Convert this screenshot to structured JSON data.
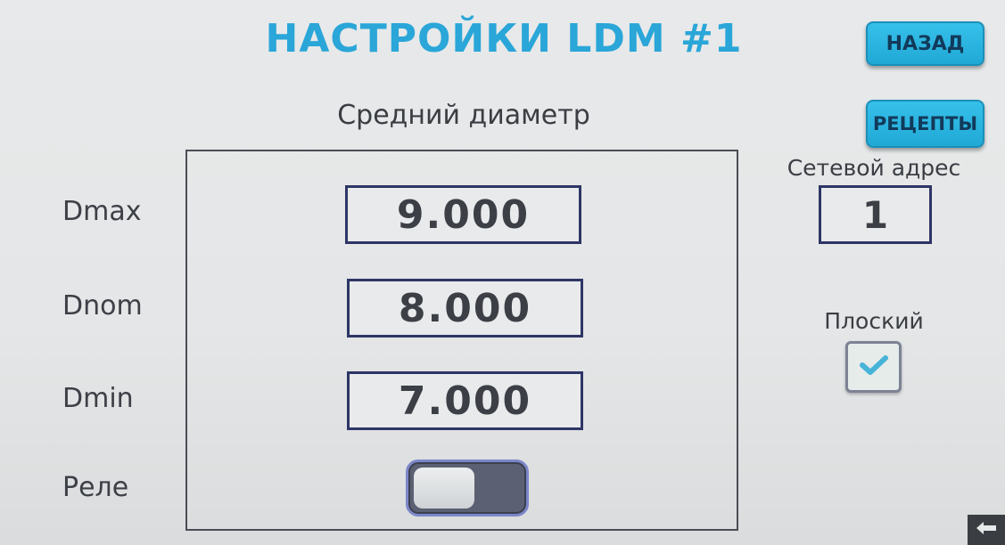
{
  "header": {
    "title": "НАСТРОЙКИ LDM #1",
    "back_label": "НАЗАД",
    "recipes_label": "РЕЦЕПТЫ"
  },
  "panel": {
    "subtitle": "Средний диаметр",
    "rows": [
      {
        "label": "Dmax",
        "value": "9.000"
      },
      {
        "label": "Dnom",
        "value": "8.000"
      },
      {
        "label": "Dmin",
        "value": "7.000"
      }
    ],
    "relay": {
      "label": "Реле",
      "state": "off"
    }
  },
  "network": {
    "label": "Сетевой адрес",
    "value": "1"
  },
  "flat": {
    "label": "Плоский",
    "checked": true,
    "icon": "checkmark-icon"
  },
  "footer": {
    "exit_icon": "arrow-left-icon"
  },
  "colors": {
    "accent": "#2aa6d8",
    "button": "#21a9d6",
    "box_border": "#2e3566",
    "check": "#46b4d8"
  }
}
